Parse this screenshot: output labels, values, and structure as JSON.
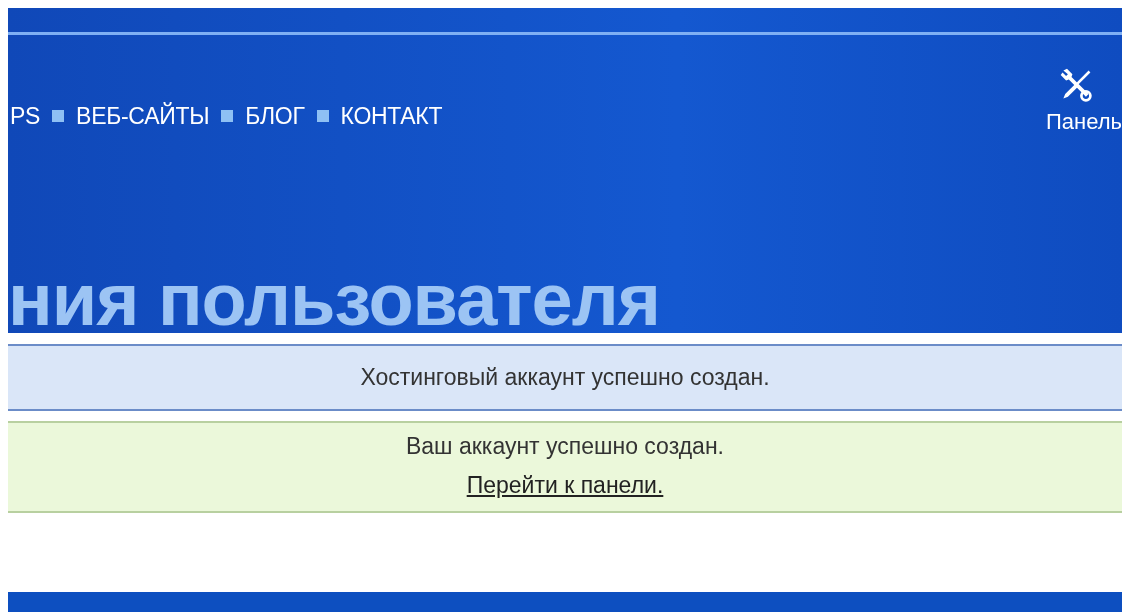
{
  "nav": {
    "items": [
      {
        "label": "PS"
      },
      {
        "label": "ВЕБ-САЙТЫ"
      },
      {
        "label": "БЛОГ"
      },
      {
        "label": "КОНТАКТ"
      }
    ]
  },
  "panel_link": {
    "label": "Панель"
  },
  "page_title": "ния пользователя",
  "alerts": [
    {
      "kind": "info",
      "lines": [
        "Хостинговый аккаунт успешно создан."
      ]
    },
    {
      "kind": "success",
      "lines": [
        "Ваш аккаунт успешно создан."
      ],
      "link": "Перейти к панели."
    }
  ]
}
